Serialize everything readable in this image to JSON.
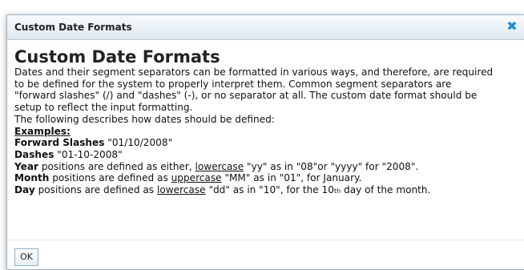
{
  "dialog": {
    "title": "Custom Date Formats",
    "close_icon": "close-x-icon",
    "heading": "Custom Date Formats",
    "para1": [
      "Dates and their segment separators can be formatted in various ways, and therefore, are required",
      "to be defined for the system to properly interpret them. Common segment separators are",
      "\"forward slashes\" (/) and \"dashes\" (-), or no separator at all. The custom date format should be",
      "setup to reflect the input formatting."
    ],
    "para2": "The following describes how dates should be defined:",
    "examples_label": "Examples:",
    "forward_label": "Forward Slashes",
    "forward_value": "\"01/10/2008\"",
    "dashes_label": "Dashes",
    "dashes_value": "\"01-10-2008\"",
    "year_label": "Year",
    "year_text1": "positions are defined as either,",
    "year_case": "lowercase",
    "year_text2": "\"yy\" as in \"08\"or \"yyyy\" for \"2008\".",
    "month_label": "Month",
    "month_text1": "positions are defined as",
    "month_case": "uppercase",
    "month_text2": "\"MM\" as in \"01\", for January.",
    "day_label": "Day",
    "day_text1": "positions are defined as",
    "day_case": "lowercase",
    "day_text2": "\"dd\" as in \"10\", for the 10",
    "day_suffix": "th",
    "day_text3": "day of the month.",
    "ok_label": "OK"
  }
}
